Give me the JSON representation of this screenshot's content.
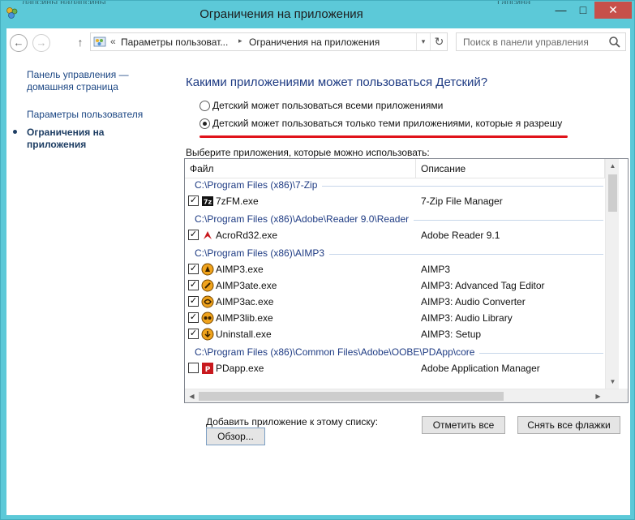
{
  "window": {
    "title": "Ограничения на приложения",
    "ghost_title_left": "лапсины  налапсины",
    "ghost_title_right": "Гапсина",
    "minimize": "—",
    "maximize": "□",
    "close": "✕"
  },
  "nav": {
    "back": "←",
    "forward": "→",
    "up": "↑",
    "breadcrumb_prefix": "«",
    "crumb1": "Параметры пользоват...",
    "crumb_sep": "▸",
    "crumb2": "Ограничения на приложения",
    "dropdown": "▾",
    "refresh": "↻",
    "search_placeholder": "Поиск в панели управления"
  },
  "sidebar": {
    "home_link": "Панель управления — домашняя страница",
    "users_link": "Параметры пользователя",
    "current": "Ограничения на приложения"
  },
  "main": {
    "heading": "Какими приложениями может пользоваться Детский?",
    "radio_all": "Детский может пользоваться всеми приложениями",
    "radio_allowed": "Детский может пользоваться только теми приложениями, которые я разрешу",
    "radio_selected": "allowed",
    "list_caption": "Выберите приложения, которые можно использовать:",
    "columns": {
      "file": "Файл",
      "description": "Описание",
      "sort_glyph": "ˆ"
    },
    "groups": [
      {
        "path": "C:\\Program Files (x86)\\7-Zip",
        "items": [
          {
            "name": "7zFM.exe",
            "description": "7-Zip File Manager",
            "checked": true,
            "icon": "7zip-icon"
          }
        ]
      },
      {
        "path": "C:\\Program Files (x86)\\Adobe\\Reader 9.0\\Reader",
        "items": [
          {
            "name": "AcroRd32.exe",
            "description": "Adobe Reader 9.1",
            "checked": true,
            "icon": "adobe-reader-icon"
          }
        ]
      },
      {
        "path": "C:\\Program Files (x86)\\AIMP3",
        "items": [
          {
            "name": "AIMP3.exe",
            "description": "AIMP3",
            "checked": true,
            "icon": "aimp-icon"
          },
          {
            "name": "AIMP3ate.exe",
            "description": "AIMP3: Advanced Tag Editor",
            "checked": true,
            "icon": "aimp-tag-icon"
          },
          {
            "name": "AIMP3ac.exe",
            "description": "AIMP3: Audio Converter",
            "checked": true,
            "icon": "aimp-converter-icon"
          },
          {
            "name": "AIMP3lib.exe",
            "description": "AIMP3: Audio Library",
            "checked": true,
            "icon": "aimp-library-icon"
          },
          {
            "name": "Uninstall.exe",
            "description": "AIMP3: Setup",
            "checked": true,
            "icon": "aimp-setup-icon"
          }
        ]
      },
      {
        "path": "C:\\Program Files (x86)\\Common Files\\Adobe\\OOBE\\PDApp\\core",
        "items": [
          {
            "name": "PDapp.exe",
            "description": "Adobe Application Manager",
            "checked": false,
            "icon": "pdapp-icon"
          }
        ]
      }
    ],
    "add_label": "Добавить приложение к этому списку:",
    "browse_button": "Обзор...",
    "check_all_button": "Отметить все",
    "clear_all_button": "Снять все флажки"
  },
  "colors": {
    "titlebar": "#5cc9d8",
    "link": "#1b4683",
    "heading": "#1e3b83",
    "annotation_red": "#e0131a",
    "close_button": "#c7504a"
  }
}
